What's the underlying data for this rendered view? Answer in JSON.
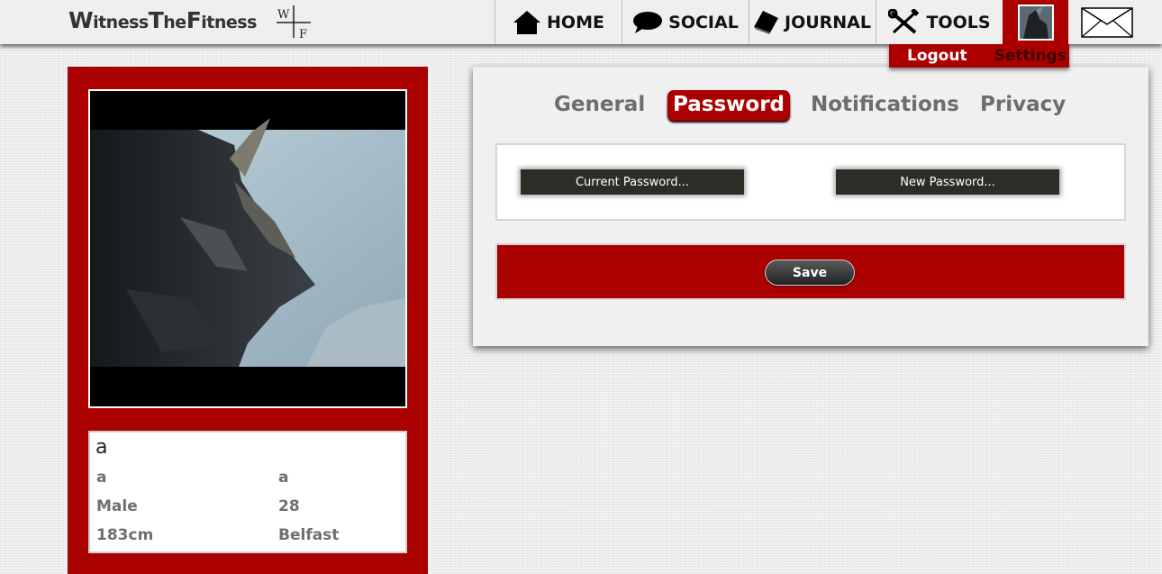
{
  "brand": {
    "name_parts": [
      "W",
      "itness",
      "T",
      "he",
      "F",
      "itness"
    ],
    "logo_letters": [
      "W",
      "F"
    ]
  },
  "nav": {
    "items": [
      {
        "label": "HOME",
        "icon": "home-icon"
      },
      {
        "label": "SOCIAL",
        "icon": "speech-bubble-icon"
      },
      {
        "label": "JOURNAL",
        "icon": "book-icon"
      },
      {
        "label": "TOOLS",
        "icon": "tools-icon"
      }
    ],
    "mail_icon": "envelope-icon",
    "avatar_icon": "user-avatar"
  },
  "user_menu": {
    "logout": "Logout",
    "settings": "Settings"
  },
  "profile": {
    "name": "a",
    "fields": [
      {
        "left": "a",
        "right": "a"
      },
      {
        "left": "Male",
        "right": "28"
      },
      {
        "left": "183cm",
        "right": "Belfast"
      }
    ]
  },
  "settings": {
    "tabs": [
      {
        "label": "General",
        "active": false
      },
      {
        "label": "Password",
        "active": true
      },
      {
        "label": "Notifications",
        "active": false
      },
      {
        "label": "Privacy",
        "active": false
      }
    ],
    "current_password_placeholder": "Current Password...",
    "new_password_placeholder": "New Password...",
    "save_label": "Save"
  },
  "colors": {
    "accent_red": "#ab0000",
    "input_dark": "#2d2d28",
    "topbar": "#efefef"
  }
}
